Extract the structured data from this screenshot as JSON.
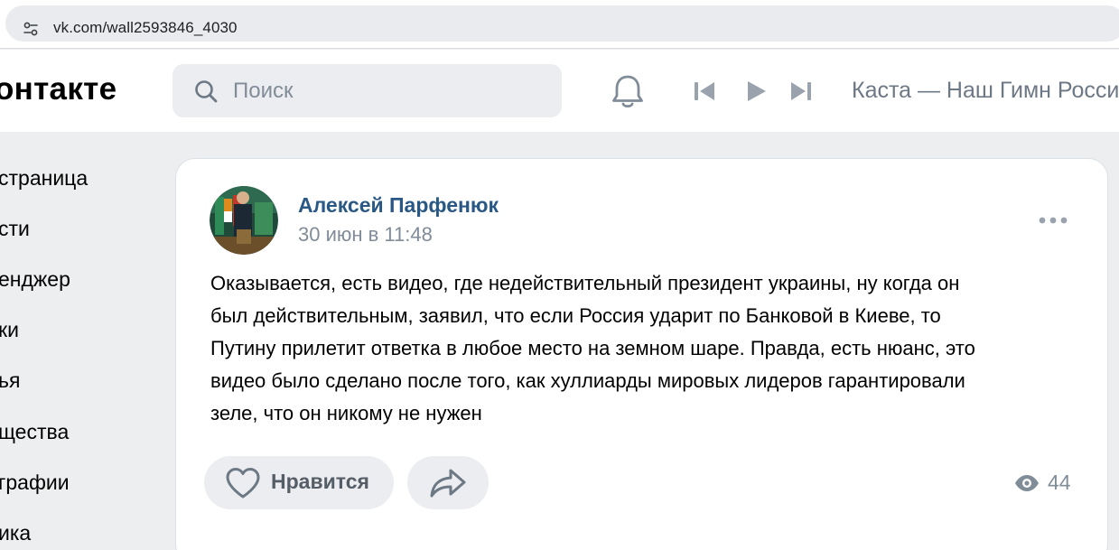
{
  "browser": {
    "url": "vk.com/wall2593846_4030",
    "site_info_icon": "tune-icon"
  },
  "header": {
    "logo_text": "онтакте",
    "search": {
      "placeholder": "Поиск",
      "icon": "search-icon"
    },
    "notifications_icon": "bell-icon",
    "player": {
      "prev_icon": "skip-previous-icon",
      "play_icon": "play-icon",
      "next_icon": "skip-next-icon",
      "track_title": "Каста — Наш Гимн Росси"
    }
  },
  "sidebar": {
    "items": [
      {
        "label": "страница"
      },
      {
        "label": "сти"
      },
      {
        "label": "енджер"
      },
      {
        "label": "ки"
      },
      {
        "label": "ья"
      },
      {
        "label": "щества"
      },
      {
        "label": "графии"
      },
      {
        "label": "ика"
      }
    ]
  },
  "post": {
    "author": "Алексей Парфенюк",
    "date": "30 июн в 11:48",
    "lines": [
      "Оказывается, есть видео, где недействительный президент украины, ну когда он",
      "был действительным, заявил, что если Россия ударит по Банковой в Киеве, то",
      "Путину прилетит ответка в любое место на земном шаре. Правда, есть нюанс, это",
      "видео было сделано после того, как хуллиарды мировых лидеров гарантировали",
      "зеле, что он никому не нужен"
    ],
    "like_label": "Нравится",
    "views": "44",
    "colors": {
      "author": "#2a5885",
      "muted": "#818c99",
      "button_bg": "#ebedf0"
    }
  }
}
